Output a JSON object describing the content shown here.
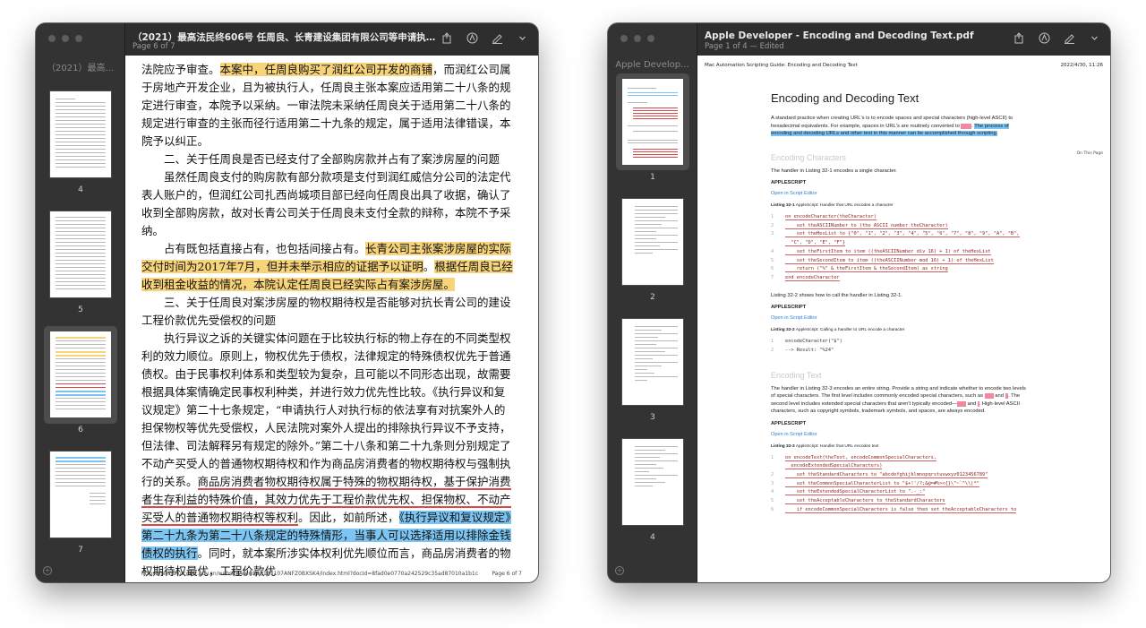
{
  "left_window": {
    "title": "（2021）最高法民终606号 任周良、长青建设集团有限公司等申请执行人执行...",
    "subtitle": "Page 6 of 7",
    "sidebar_title": "（2021）最高...",
    "thumbnails": [
      "4",
      "5",
      "6",
      "7"
    ],
    "selected_thumbnail": "6",
    "toolbar": [
      "share-icon",
      "markup-icon",
      "pen-icon",
      "chevron-down-icon"
    ],
    "paragraphs": [
      {
        "segs": [
          {
            "t": "法院应予审查。",
            "s": ""
          },
          {
            "t": "本案中，任周良购买了润红公司开发的商铺",
            "s": "y"
          },
          {
            "t": "，而润红公司属于房地产开发企业，且为被执行人，任周良主张本案应适用第二十八条的规定进行审查，本院予以采纳。一审法院未采纳任周良关于适用第二十八条的规定进行审查的主张而径行适用第二十九条的规定，属于适用法律错误，本院予以纠正。",
            "s": ""
          }
        ]
      },
      {
        "segs": [
          {
            "t": "　　二、关于任周良是否已经支付了全部购房款并占有了案涉房屋的问题",
            "s": ""
          }
        ]
      },
      {
        "segs": [
          {
            "t": "　　虽然任周良支付的购房款有部分款项是支付到润红威信分公司的法定代表人账户的，但润红公司扎西尚城项目部已经向任周良出具了收据，确认了收到全部购房款，故对长青公司关于任周良未支付全款的辩称，本院不予采纳。",
            "s": ""
          }
        ]
      },
      {
        "segs": [
          {
            "t": "　　占有既包括直接占有，也包括间接占有。",
            "s": ""
          },
          {
            "t": "长青公司主张案涉房屋的实际交付时间为2017年7月，但并未举示相应的证据予以证明",
            "s": "y"
          },
          {
            "t": "。",
            "s": ""
          },
          {
            "t": "根据任周良已经收到租金收益的情况，本院认定任周良已经实际占有案涉房屋。",
            "s": "y"
          }
        ]
      },
      {
        "segs": [
          {
            "t": "　　三、关于任周良对案涉房屋的物权期待权是否能够对抗长青公司的建设工程价款优先受偿权的问题",
            "s": ""
          }
        ]
      },
      {
        "segs": [
          {
            "t": "　　执行异议之诉的关键实体问题在于比较执行标的物上存在的不同类型权利的效力顺位。原则上，物权优先于债权，法律规定的特殊债权优先于普通债权。由于民事权利体系和类型较为复杂，且可能以不同形态出现，故需要根据具体案情确定民事权利种类，并进行效力优先性比较。《执行异议和复议规定》第二十七条规定，“申请执行人对执行标的依法享有对抗案外人的担保物权等优先受偿权，人民法院对案外人提出的排除执行异议不予支持，但法律、司法解释另有规定的除外。”第二十八条和第二十九条则分别规定了不动产买受人的普通物权期待权和作为商品房消费者的物权期待权与强制执行的关系。",
            "s": ""
          },
          {
            "t": "商品房消费者物权期待权属于特殊的物权期待权，基于保护消费者生存利益的特殊价值，其效力优先于工程价款优先权、担保物权、不动产买受人的普通物权期待权等权利",
            "s": "u"
          },
          {
            "t": "。因此，如前所述，",
            "s": ""
          },
          {
            "t": "《执行异议和复议规定》第二十九条为第二十八条规定的特殊情形，当事人可以选择适用以排除金钱债权的执行",
            "s": "b"
          },
          {
            "t": "。同时，就本案所涉实体权利优先顺位而言，商品房消费者的物权期待权最优，工程价款优",
            "s": ""
          }
        ]
      }
    ],
    "footer_url": "https://wenshu.court.gov.cn/website/wenshu/181107ANFZ0BXSK4/index.html?docId=8fad0e0770a242529c35ad87010a1b1c",
    "footer_page": "Page 6 of 7"
  },
  "right_window": {
    "title": "Apple Developer - Encoding and Decoding Text.pdf",
    "subtitle": "Page 1 of 4 — Edited",
    "sidebar_title": "Apple Develop...",
    "thumbnails": [
      "1",
      "2",
      "3",
      "4"
    ],
    "selected_thumbnail": "1",
    "header_left": "Mac Automation Scripting Guide: Encoding and Decoding Text",
    "header_right": "2022/4/30, 11:26",
    "on_this_page": "On This Page",
    "h1": "Encoding and Decoding Text",
    "intro_a": "A standard practice when creating URL's is to encode spaces and special characters (high-level ASCII) to hexadecimal equivalents. For example, spaces in URL's are routinely converted to ",
    "intro_hl": "The process of encoding and decoding URLs and other text in this manner can be accomplished through scripting.",
    "sec1": "Encoding Characters",
    "sec1_p": "The handler in Listing 32-1 encodes a single character.",
    "applescript": "APPLESCRIPT",
    "open_in_editor": "Open in Script Editor",
    "cap1_num": "Listing 32-1",
    "cap1": "AppleScript: Handler that URL encodes a character",
    "code1": [
      "on encodeCharacter(theCharacter)",
      "    set theASCIINumber to (the ASCII number theCharacter)",
      "    set theHexList to {\"0\", \"1\", \"2\", \"3\", \"4\", \"5\", \"6\", \"7\", \"8\", \"9\", \"A\", \"B\",",
      "  \"C\", \"D\", \"E\", \"F\"}",
      "    set theFirstItem to item ((theASCIINumber div 16) + 1) of theHexList",
      "    set theSecondItem to item ((theASCIINumber mod 16) + 1) of theHexList",
      "    return (\"%\" & theFirstItem & theSecondItem) as string",
      "end encodeCharacter"
    ],
    "code1_nums": [
      "1",
      "2",
      "3",
      "",
      "4",
      "5",
      "6",
      "7"
    ],
    "mid_p": "Listing 32-2 shows how to call the handler in Listing 32-1.",
    "cap2_num": "Listing 32-2",
    "cap2": "AppleScript: Calling a handler to URL encode a character",
    "code2": [
      "encodeCharacter(\"$\")",
      "--> Result: \"%24\""
    ],
    "code2_nums": [
      "1",
      "2"
    ],
    "sec2": "Encoding Text",
    "sec2_p_a": "The handler in Listing 32-3 encodes an entire string. Provide a string and indicate whether to encode two levels of special characters. The first level includes commonly encoded special characters, such as ",
    "sec2_p_b": " and ",
    "sec2_p_c": ". The second level includes extended special characters that aren't typically encoded—",
    "sec2_p_d": " and ",
    "sec2_p_e": ". High-level ASCII characters, such as copyright symbols, trademark symbols, and spaces, are always encoded.",
    "cap3_num": "Listing 32-3",
    "cap3": "AppleScript: Handler that URL encodes text",
    "code3": [
      "on encodeText(theText, encodeCommonSpecialCharacters,",
      "  encodeExtendedSpecialCharacters)",
      "    set theStandardCharacters to \"abcdefghijklmnopqrstuvwxyz0123456789\"",
      "    set theCommonSpecialCharacterList to \"$+!'/?;&@=#%><{}\\\"~`^\\\\|*\"",
      "    set theExtendedSpecialCharacterList to \".-_:\"",
      "    set theAcceptableCharacters to theStandardCharacters",
      "    if encodeCommonSpecialCharacters is false then set theAcceptableCharacters to"
    ],
    "code3_nums": [
      "1",
      "",
      "2",
      "3",
      "4",
      "5",
      "6"
    ]
  }
}
